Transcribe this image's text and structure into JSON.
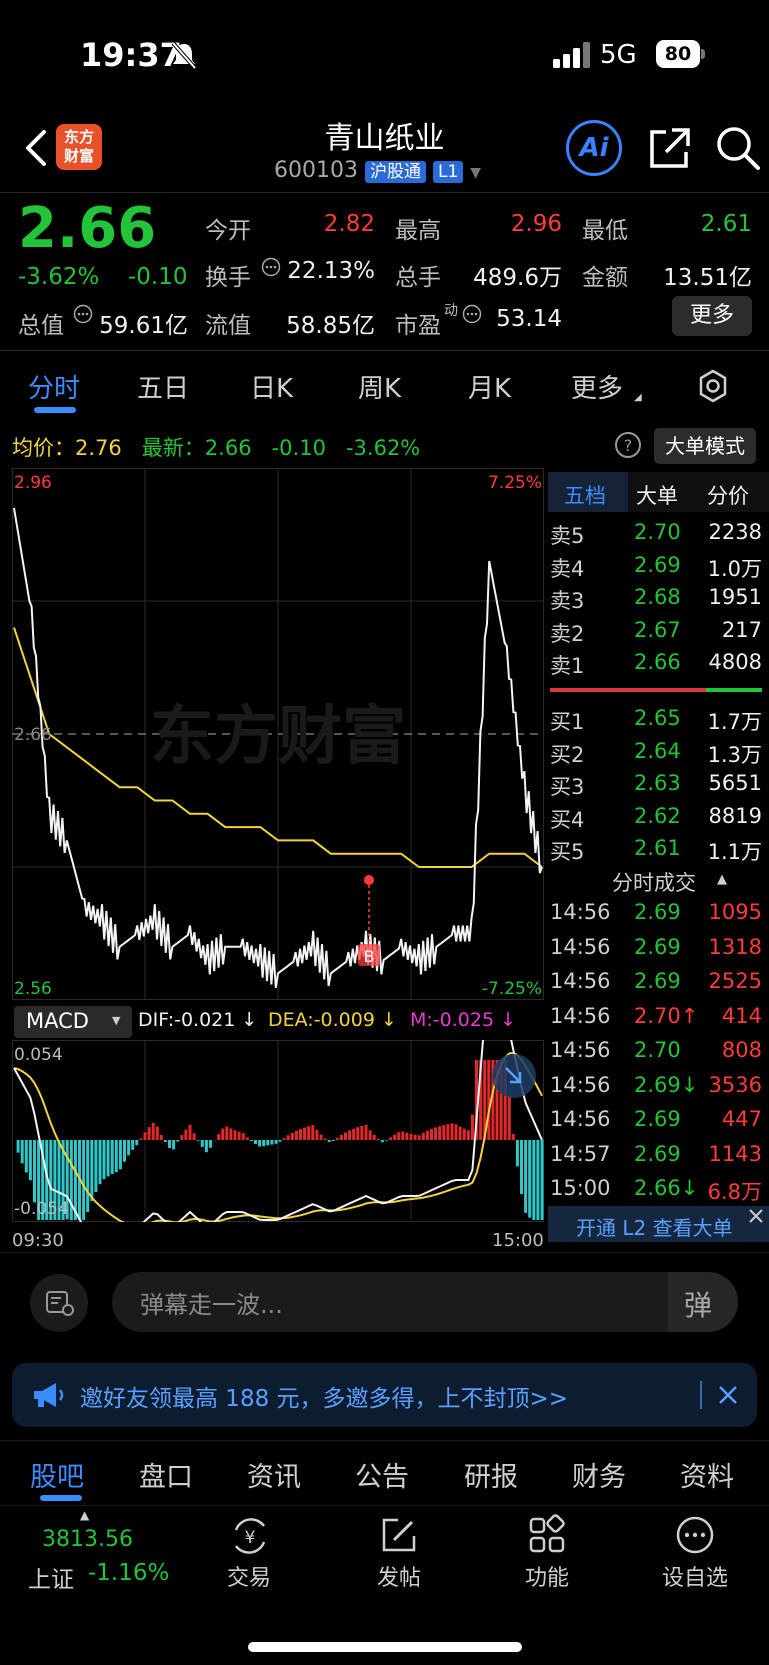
{
  "status": {
    "time": "19:37",
    "network": "5G",
    "battery": "80"
  },
  "header": {
    "logo_line1": "东方",
    "logo_line2": "财富",
    "title": "青山纸业",
    "code": "600103",
    "tag_connect": "沪股通",
    "tag_level": "L1",
    "ai_label": "Ai"
  },
  "quote": {
    "price": "2.66",
    "change_pct": "-3.62%",
    "change": "-0.10",
    "open_label": "今开",
    "open": "2.82",
    "high_label": "最高",
    "high": "2.96",
    "low_label": "最低",
    "low": "2.61",
    "turnover_label": "换手",
    "turnover": "22.13%",
    "volume_label": "总手",
    "volume": "489.6万",
    "amount_label": "金额",
    "amount": "13.51亿",
    "mktcap_label": "总值",
    "mktcap": "59.61亿",
    "float_label": "流值",
    "float": "58.85亿",
    "pe_label": "市盈",
    "pe_super": "动",
    "pe": "53.14",
    "more_label": "更多"
  },
  "period_tabs": [
    "分时",
    "五日",
    "日K",
    "周K",
    "月K",
    "更多"
  ],
  "chart_info": {
    "avg_label": "均价：",
    "avg": "2.76",
    "latest_label": "最新：",
    "latest": "2.66",
    "latest_change": "-0.10",
    "latest_pct": "-3.62%",
    "mode_button": "大单模式"
  },
  "chart_data": {
    "type": "line",
    "y_top": "2.96",
    "y_mid": "2.66",
    "y_bottom": "2.56",
    "pct_top": "7.25%",
    "pct_bottom": "-7.25%",
    "x_start": "09:30",
    "x_end": "15:00",
    "marker": "B",
    "watermark": "东方财富",
    "price_series": [
      2.93,
      2.85,
      2.7,
      2.68,
      2.63,
      2.62,
      2.6,
      2.61,
      2.62,
      2.6,
      2.61,
      2.59,
      2.6,
      2.6,
      2.59,
      2.58,
      2.59,
      2.6,
      2.58,
      2.59,
      2.6,
      2.59,
      2.6,
      2.59,
      2.6,
      2.61,
      2.61,
      2.89,
      2.82,
      2.72,
      2.66
    ],
    "avg_series": [
      2.84,
      2.8,
      2.76,
      2.75,
      2.74,
      2.73,
      2.72,
      2.72,
      2.71,
      2.71,
      2.7,
      2.7,
      2.69,
      2.69,
      2.69,
      2.68,
      2.68,
      2.68,
      2.67,
      2.67,
      2.67,
      2.67,
      2.67,
      2.66,
      2.66,
      2.66,
      2.66,
      2.67,
      2.67,
      2.67,
      2.66
    ]
  },
  "macd": {
    "label": "MACD",
    "dif": "DIF:-0.021 ↓",
    "dea": "DEA:-0.009 ↓",
    "m": "M:-0.025 ↓",
    "top": "0.054",
    "bottom": "-0.054"
  },
  "order_book": {
    "tabs": [
      "五档",
      "大单",
      "分价"
    ],
    "asks": [
      {
        "label": "卖5",
        "price": "2.70",
        "volume": "2238"
      },
      {
        "label": "卖4",
        "price": "2.69",
        "volume": "1.0万"
      },
      {
        "label": "卖3",
        "price": "2.68",
        "volume": "1951"
      },
      {
        "label": "卖2",
        "price": "2.67",
        "volume": "217"
      },
      {
        "label": "卖1",
        "price": "2.66",
        "volume": "4808"
      }
    ],
    "bids": [
      {
        "label": "买1",
        "price": "2.65",
        "volume": "1.7万"
      },
      {
        "label": "买2",
        "price": "2.64",
        "volume": "1.3万"
      },
      {
        "label": "买3",
        "price": "2.63",
        "volume": "5651"
      },
      {
        "label": "买4",
        "price": "2.62",
        "volume": "8819"
      },
      {
        "label": "买5",
        "price": "2.61",
        "volume": "1.1万"
      }
    ],
    "trades_title": "分时成交",
    "trades": [
      {
        "time": "14:56",
        "price": "2.69",
        "volume": "1095"
      },
      {
        "time": "14:56",
        "price": "2.69",
        "volume": "1318"
      },
      {
        "time": "14:56",
        "price": "2.69",
        "volume": "2525"
      },
      {
        "time": "14:56",
        "price": "2.70↑",
        "volume": "414"
      },
      {
        "time": "14:56",
        "price": "2.70",
        "volume": "808"
      },
      {
        "time": "14:56",
        "price": "2.69↓",
        "volume": "3536"
      },
      {
        "time": "14:56",
        "price": "2.69",
        "volume": "447"
      },
      {
        "time": "14:57",
        "price": "2.69",
        "volume": "1143"
      },
      {
        "time": "15:00",
        "price": "2.66↓",
        "volume": "6.8万"
      }
    ],
    "l2_promo": "开通 L2 查看大单"
  },
  "danmu": {
    "placeholder": "弹幕走一波...",
    "button": "弹"
  },
  "banner": {
    "text": "邀好友领最高 188 元，多邀多得，上不封顶>>"
  },
  "bottom_tabs": [
    "股吧",
    "盘口",
    "资讯",
    "公告",
    "研报",
    "财务",
    "资料"
  ],
  "dock": {
    "index_value": "3813.56",
    "index_name": "上证",
    "index_change": "-1.16%",
    "items": [
      "交易",
      "发帖",
      "功能",
      "设自选"
    ]
  },
  "colors": {
    "up": "#ff3b3b",
    "down": "#22c43a",
    "accent": "#3a8cff",
    "avg_line": "#f2d43a"
  }
}
